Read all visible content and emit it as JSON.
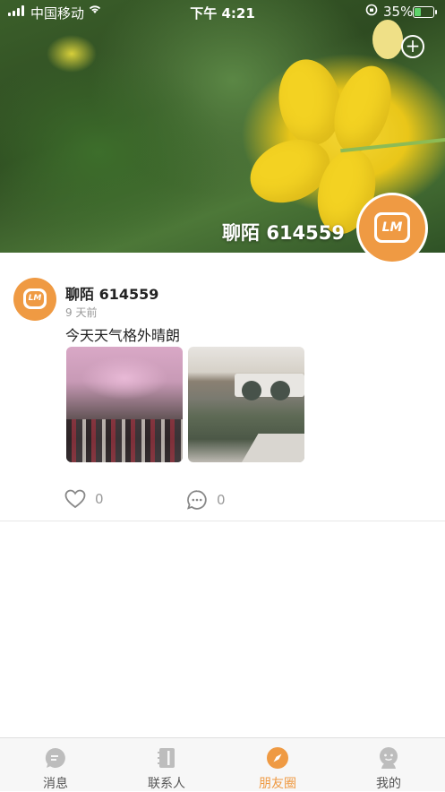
{
  "status_bar": {
    "carrier": "中国移动",
    "time": "下午 4:21",
    "battery": "35%",
    "battery_level": 0.35
  },
  "profile": {
    "name": "聊陌 614559",
    "avatar_text": "LM"
  },
  "post": {
    "author": "聊陌 614559",
    "time_ago": "9 天前",
    "text": "今天天气格外晴朗",
    "avatar_text": "LM",
    "likes": "0",
    "comments": "0"
  },
  "tabs": [
    {
      "label": "消息",
      "icon": "message-icon"
    },
    {
      "label": "联系人",
      "icon": "contacts-icon"
    },
    {
      "label": "朋友圈",
      "icon": "compass-icon"
    },
    {
      "label": "我的",
      "icon": "profile-icon"
    }
  ],
  "colors": {
    "accent": "#ef9a43",
    "tab_inactive": "#bdbdbd"
  }
}
